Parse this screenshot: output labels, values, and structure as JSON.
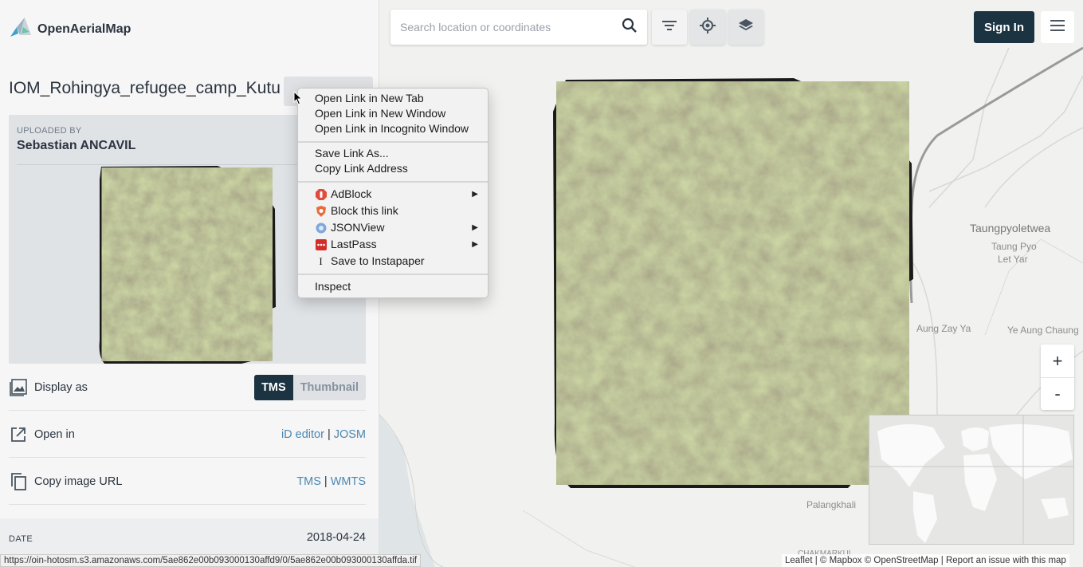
{
  "app": {
    "name": "OpenAerialMap"
  },
  "search": {
    "placeholder": "Search location or coordinates"
  },
  "header": {
    "sign_in": "Sign In"
  },
  "image": {
    "title": "IOM_Rohingya_refugee_camp_Kutu",
    "uploaded_by_label": "UPLOADED BY",
    "uploader": "Sebastian ANCAVIL",
    "date_label": "DATE",
    "date": "2018-04-24"
  },
  "display_as": {
    "label": "Display as",
    "options": [
      "TMS",
      "Thumbnail"
    ],
    "selected": "TMS"
  },
  "open_in": {
    "label": "Open in",
    "editor_1": "iD editor",
    "sep": "|",
    "editor_2": "JOSM"
  },
  "copy_url": {
    "label": "Copy image URL",
    "fmt_1": "TMS",
    "sep": "|",
    "fmt_2": "WMTS"
  },
  "context_menu": {
    "open_new_tab": "Open Link in New Tab",
    "open_new_window": "Open Link in New Window",
    "open_incognito": "Open Link in Incognito Window",
    "save_link": "Save Link As...",
    "copy_link": "Copy Link Address",
    "adblock": "AdBlock",
    "block_link": "Block this link",
    "jsonview": "JSONView",
    "lastpass": "LastPass",
    "instapaper": "Save to Instapaper",
    "inspect": "Inspect"
  },
  "map_labels": {
    "taungpyoletwea": "Taungpyoletwea",
    "taung_pyo": "Taung Pyo",
    "let_yar": "Let Yar",
    "aung_zay_ya": "Aung Zay Ya",
    "ye_aung_chaung": "Ye Aung Chaung",
    "palangkhali": "Palangkhali",
    "bottom_cut": "CHAKMARKUL"
  },
  "zoom": {
    "in": "+",
    "out": "-"
  },
  "attribution": {
    "leaflet": "Leaflet",
    "mapbox": "© Mapbox",
    "osm": "© OpenStreetMap",
    "report": "Report an issue with this map"
  },
  "status_url": "https://oin-hotosm.s3.amazonaws.com/5ae862e00b093000130affd9/0/5ae862e00b093000130affda.tif",
  "icons": {
    "search": "search-icon",
    "filter": "filter-icon",
    "locate": "crosshair-icon",
    "layers": "layers-icon",
    "menu": "hamburger-menu-icon"
  }
}
